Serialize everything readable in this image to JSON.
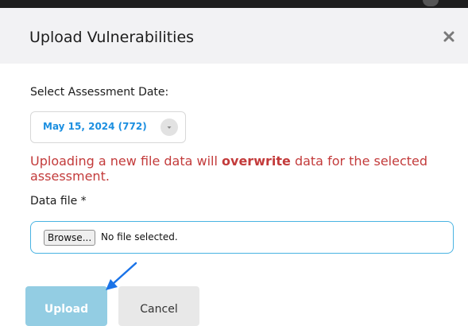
{
  "dialog": {
    "title": "Upload Vulnerabilities",
    "close_icon": "close-icon"
  },
  "assessment": {
    "label": "Select Assessment Date:",
    "selected_value": "May 15, 2024 (772)",
    "dropdown_icon": "chevron-down-icon",
    "accent_color": "#1c8fe0"
  },
  "warning": {
    "text_before": "Uploading a new file data will ",
    "emphasis": "overwrite",
    "text_after": " data for the selected assessment.",
    "color": "#c33b3b"
  },
  "data_file": {
    "label": "Data file *",
    "browse_label": "Browse...",
    "status": "No file selected."
  },
  "actions": {
    "upload_label": "Upload",
    "cancel_label": "Cancel",
    "upload_color": "#93cde3"
  },
  "annotation": {
    "arrow_icon": "pointer-arrow-icon",
    "arrow_color": "#1a73e8"
  }
}
